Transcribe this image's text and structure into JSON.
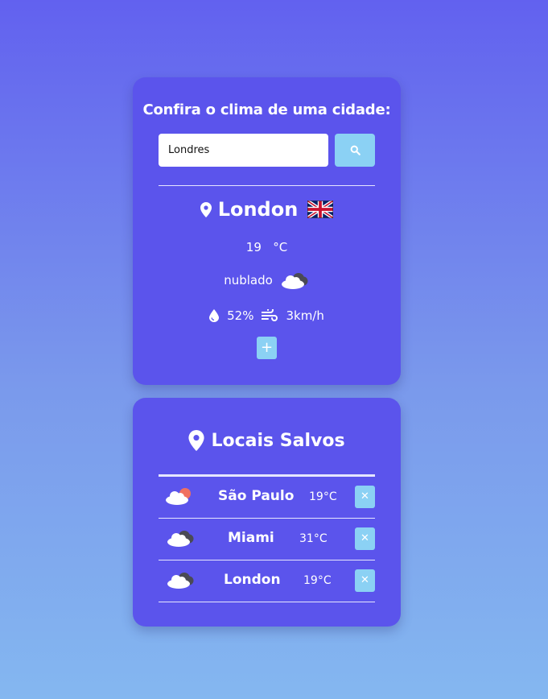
{
  "search": {
    "title": "Confira o clima de uma cidade:",
    "input_value": "Londres",
    "button_icon": "search-icon"
  },
  "weather": {
    "city": "London",
    "location_icon": "map-pin-icon",
    "flag_icon": "uk-flag-icon",
    "temperature": "19",
    "unit": "°C",
    "description": "nublado",
    "description_icon": "cloudy-icon",
    "humidity_icon": "droplet-icon",
    "humidity": "52%",
    "wind_icon": "wind-icon",
    "wind": "3km/h",
    "add_label": "+"
  },
  "saved": {
    "title": "Locais Salvos",
    "title_icon": "map-pin-icon",
    "items": [
      {
        "city": "São Paulo",
        "temp": "19°C",
        "icon": "partly-sunny-icon",
        "remove_label": "✕"
      },
      {
        "city": "Miami",
        "temp": "31°C",
        "icon": "cloudy-icon",
        "remove_label": "✕"
      },
      {
        "city": "London",
        "temp": "19°C",
        "icon": "cloudy-icon",
        "remove_label": "✕"
      }
    ]
  },
  "colors": {
    "card": "#5b54ec",
    "button": "#8bd1f4",
    "text": "#ffffff"
  }
}
